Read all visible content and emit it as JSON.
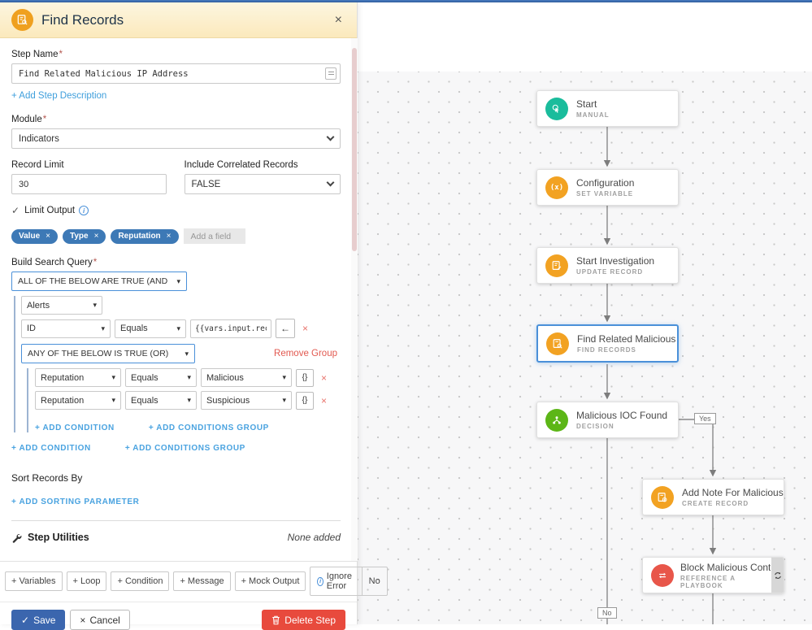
{
  "icons": {
    "close": "×",
    "chip_close": "×",
    "check": "✓",
    "cancel_x": "×",
    "back_arrow": "←",
    "braces": "{}",
    "info": "i",
    "plus": "+",
    "set_variable_glyph": "(x)"
  },
  "panel": {
    "header": {
      "title": "Find Records"
    },
    "step_name": {
      "label": "Step Name",
      "required": "*",
      "value": "Find Related Malicious IP Address"
    },
    "add_step_description": "+ Add Step Description",
    "module": {
      "label": "Module",
      "required": "*",
      "value": "Indicators"
    },
    "record_limit": {
      "label": "Record Limit",
      "value": "30"
    },
    "include_correlated": {
      "label": "Include Correlated Records",
      "value": "FALSE"
    },
    "limit_output": {
      "label": "Limit Output"
    },
    "fields": {
      "chips": [
        "Value",
        "Type",
        "Reputation"
      ],
      "add_placeholder": "Add a field"
    },
    "query": {
      "label": "Build Search Query",
      "required": "*",
      "root_operator": "ALL OF THE BELOW ARE TRUE (AND",
      "group_module": "Alerts",
      "condition1": {
        "field": "ID",
        "op": "Equals",
        "value": "{{vars.input.recor"
      },
      "nested_operator": "ANY OF THE BELOW IS TRUE (OR)",
      "remove_group": "Remove Group",
      "condition2": {
        "field": "Reputation",
        "op": "Equals",
        "value": "Malicious"
      },
      "condition3": {
        "field": "Reputation",
        "op": "Equals",
        "value": "Suspicious"
      },
      "add_condition": "+ ADD CONDITION",
      "add_group": "+ ADD CONDITIONS GROUP"
    },
    "sort": {
      "label": "Sort Records By",
      "add": "+ ADD SORTING PARAMETER"
    },
    "utilities": {
      "label": "Step Utilities",
      "status": "None added"
    },
    "toolbar": [
      "+ Variables",
      "+ Loop",
      "+ Condition",
      "+ Message",
      "+ Mock Output"
    ],
    "ignore_error": {
      "label": "Ignore Error",
      "value": "No"
    },
    "actions": {
      "save": "Save",
      "cancel": "Cancel",
      "delete": "Delete Step"
    }
  },
  "canvas": {
    "nodes": [
      {
        "title": "Start",
        "type": "MANUAL",
        "color": "#1abc9c"
      },
      {
        "title": "Configuration",
        "type": "SET VARIABLE",
        "color": "#f2a222"
      },
      {
        "title": "Start Investigation",
        "type": "UPDATE RECORD",
        "color": "#f2a222"
      },
      {
        "title": "Find Related Malicious IP ...",
        "type": "FIND RECORDS",
        "color": "#f2a222"
      },
      {
        "title": "Malicious IOC Found",
        "type": "DECISION",
        "color": "#5cb617"
      },
      {
        "title": "Add Note For Malicious I...",
        "type": "CREATE RECORD",
        "color": "#f2a222"
      },
      {
        "title": "Block Malicious Content",
        "type": "REFERENCE A PLAYBOOK",
        "color": "#e8564a"
      }
    ],
    "edge_labels": {
      "yes": "Yes",
      "no": "No"
    }
  }
}
